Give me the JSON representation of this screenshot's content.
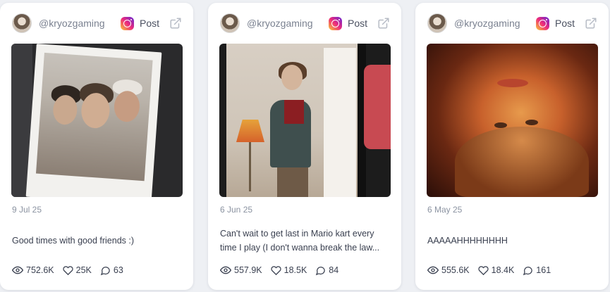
{
  "cards": [
    {
      "username": "@kryozgaming",
      "post_label": "Post",
      "date": "9 Jul 25",
      "caption": "Good times with good friends :)",
      "views": "752.6K",
      "likes": "25K",
      "comments": "63"
    },
    {
      "username": "@kryozgaming",
      "post_label": "Post",
      "date": "6 Jun 25",
      "caption": "Can't wait to get last in Mario kart every time I play (I don't wanna break the law...",
      "views": "557.9K",
      "likes": "18.5K",
      "comments": "84"
    },
    {
      "username": "@kryozgaming",
      "post_label": "Post",
      "date": "6 May 25",
      "caption": "AAAAAHHHHHHHH",
      "views": "555.6K",
      "likes": "18.4K",
      "comments": "161"
    }
  ],
  "icons": {
    "platform": "instagram-icon",
    "open": "external-link-icon",
    "views": "eye-icon",
    "likes": "heart-icon",
    "comments": "comment-icon"
  }
}
